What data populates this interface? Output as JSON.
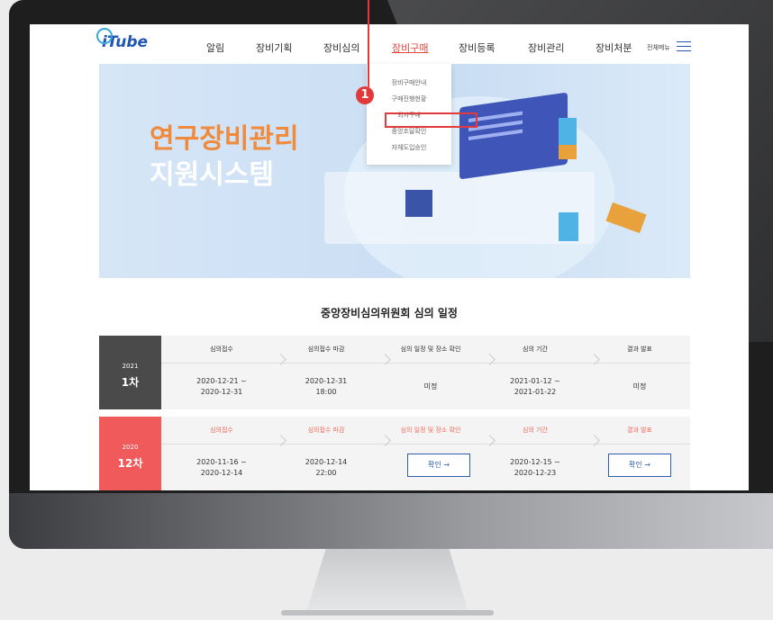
{
  "logo": "iTube",
  "nav": [
    "알림",
    "장비기획",
    "장비심의",
    "장비구매",
    "장비등록",
    "장비관리",
    "장비처분"
  ],
  "nav_active_index": 3,
  "all_menu": "전체메뉴",
  "dropdown": [
    "장비구매안내",
    "구매진행현황",
    "외자구매",
    "중앙조달확인",
    "자체도입승인"
  ],
  "dropdown_highlight_index": 1,
  "callout_number": "1",
  "hero": {
    "line1": "연구장비관리",
    "line2": "지원시스템"
  },
  "schedule": {
    "title": "중앙장비심의위원회 심의 일정",
    "headers": [
      "심의접수",
      "심의접수 마감",
      "심의 일정 및 장소 확인",
      "심의 기간",
      "결과 발표"
    ],
    "rows": [
      {
        "year": "2021",
        "round": "1차",
        "color": "#4a4a4a",
        "cells": [
          "2020-12-21 ~\n2020-12-31",
          "2020-12-31\n18:00",
          "미정",
          "2021-01-12 ~\n2021-01-22",
          "미정"
        ]
      },
      {
        "year": "2020",
        "round": "12차",
        "color": "#f05a5a",
        "cells": [
          "2020-11-16 ~\n2020-12-14",
          "2020-12-14\n22:00",
          "확인",
          "2020-12-15 ~\n2020-12-23",
          "확인"
        ]
      }
    ]
  },
  "confirm_arrow": "→",
  "colors": {
    "accent": "#e2463d",
    "brand": "#1f56b0"
  }
}
